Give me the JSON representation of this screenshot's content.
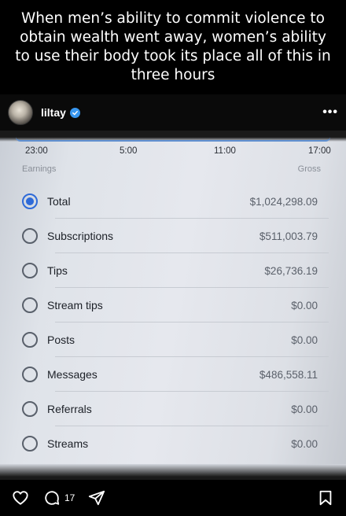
{
  "caption": {
    "text": "When men’s ability to commit violence to obtain wealth went away, women’s ability to use their body took its place all of this in three hours"
  },
  "post": {
    "username": "liltay",
    "verified_icon": "verified-badge-icon",
    "more_icon": "more-options-icon"
  },
  "photo": {
    "time_axis": [
      "23:00",
      "5:00",
      "11:00",
      "17:00"
    ],
    "left_header": "Earnings",
    "right_header": "Gross",
    "rows": [
      {
        "label": "Total",
        "value": "$1,024,298.09",
        "selected": true
      },
      {
        "label": "Subscriptions",
        "value": "$511,003.79",
        "selected": false
      },
      {
        "label": "Tips",
        "value": "$26,736.19",
        "selected": false
      },
      {
        "label": "Stream tips",
        "value": "$0.00",
        "selected": false
      },
      {
        "label": "Posts",
        "value": "$0.00",
        "selected": false
      },
      {
        "label": "Messages",
        "value": "$486,558.11",
        "selected": false
      },
      {
        "label": "Referrals",
        "value": "$0.00",
        "selected": false
      },
      {
        "label": "Streams",
        "value": "$0.00",
        "selected": false
      }
    ],
    "accent_color": "#2e6ad8"
  },
  "actions": {
    "comment_count": "17",
    "icons": [
      "heart-icon",
      "comment-icon",
      "share-icon",
      "bookmark-icon"
    ]
  }
}
